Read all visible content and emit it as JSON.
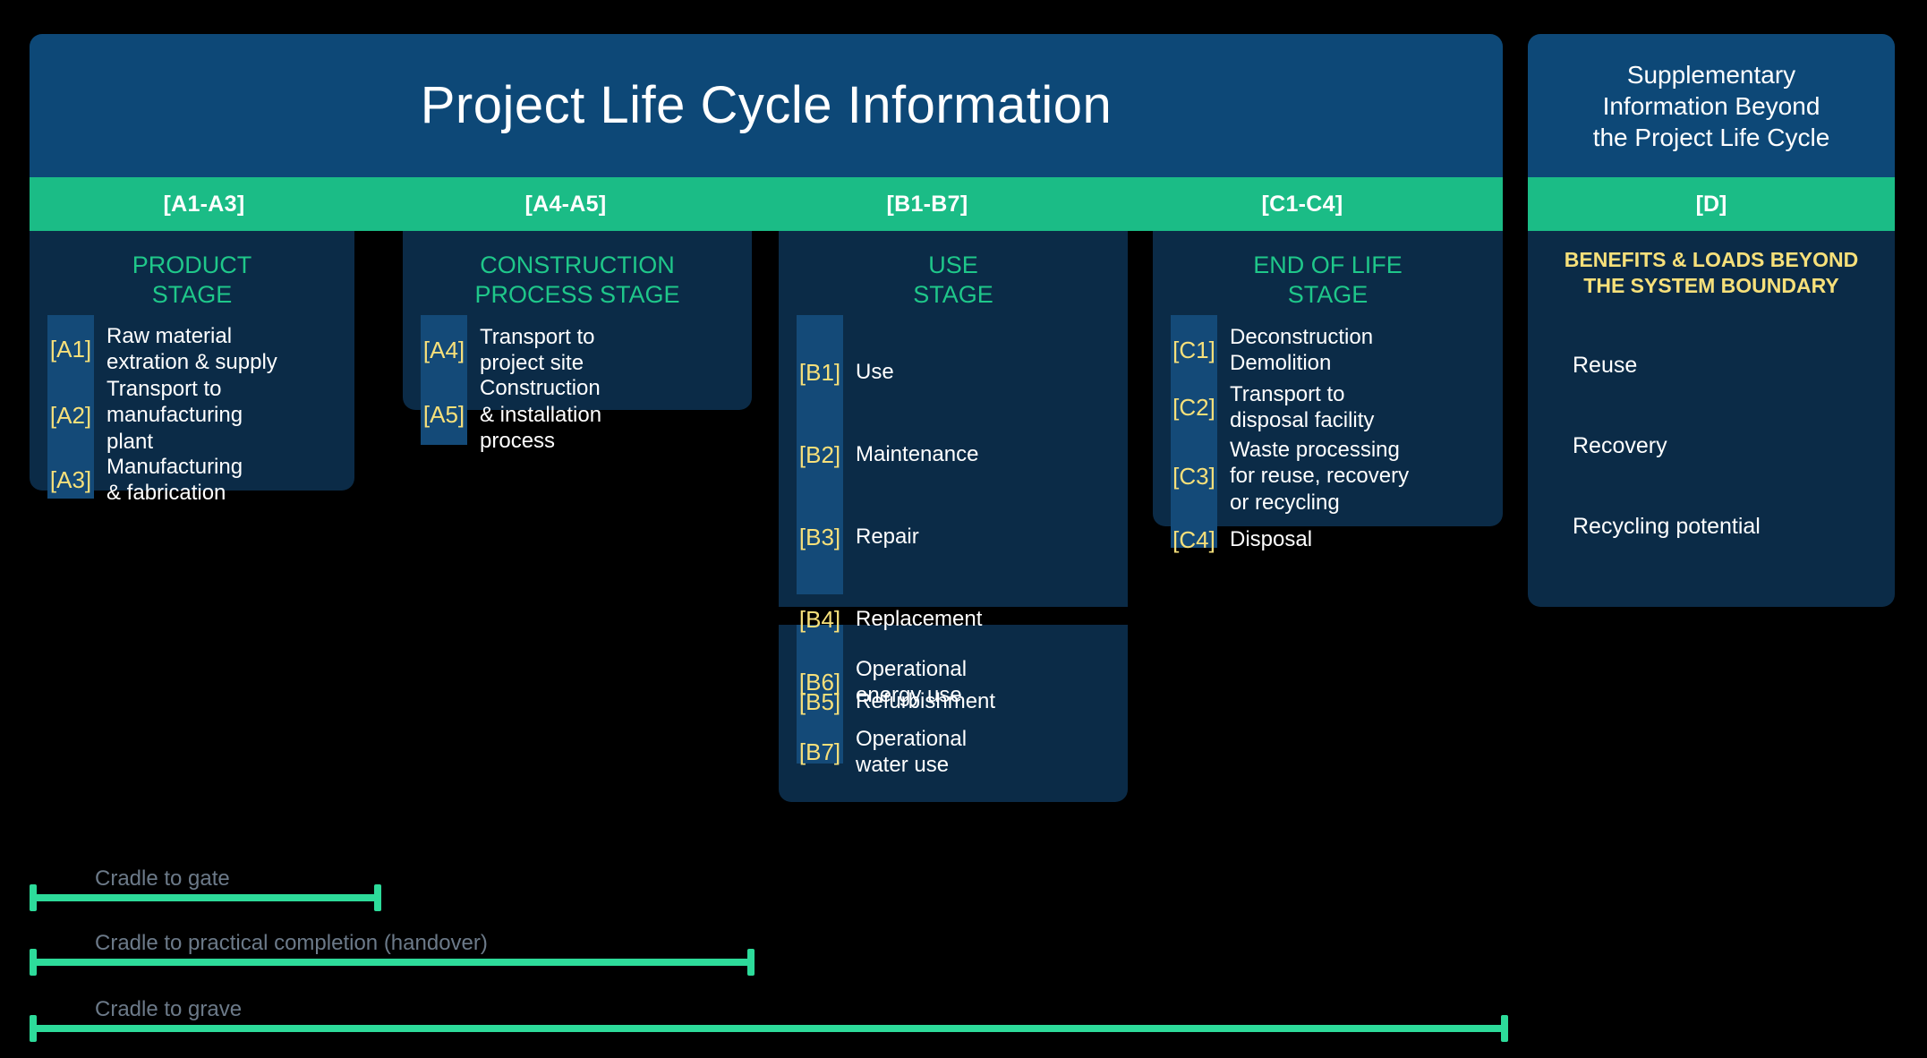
{
  "main": {
    "title": "Project Life Cycle Information",
    "code_bands": [
      "[A1-A3]",
      "[A4-A5]",
      "[B1-B7]",
      "[C1-C4]"
    ],
    "columns": [
      {
        "stage_title": "PRODUCT\nSTAGE",
        "items": [
          {
            "code": "[A1]",
            "label": "Raw material\nextration & supply"
          },
          {
            "code": "[A2]",
            "label": "Transport to\nmanufacturing\nplant"
          },
          {
            "code": "[A3]",
            "label": "Manufacturing\n& fabrication"
          }
        ]
      },
      {
        "stage_title": "CONSTRUCTION\nPROCESS STAGE",
        "items": [
          {
            "code": "[A4]",
            "label": "Transport to\nproject site"
          },
          {
            "code": "[A5]",
            "label": "Construction\n& installation\nprocess"
          }
        ]
      },
      {
        "stage_title": "USE\nSTAGE",
        "items": [
          {
            "code": "[B1]",
            "label": "Use"
          },
          {
            "code": "[B2]",
            "label": "Maintenance"
          },
          {
            "code": "[B3]",
            "label": "Repair"
          },
          {
            "code": "[B4]",
            "label": "Replacement"
          },
          {
            "code": "[B5]",
            "label": "Refurbishment"
          }
        ],
        "items_lower": [
          {
            "code": "[B6]",
            "label": "Operational\nenergy use"
          },
          {
            "code": "[B7]",
            "label": "Operational\nwater use"
          }
        ]
      },
      {
        "stage_title": "END OF LIFE\nSTAGE",
        "items": [
          {
            "code": "[C1]",
            "label": "Deconstruction\nDemolition"
          },
          {
            "code": "[C2]",
            "label": "Transport to\ndisposal facility"
          },
          {
            "code": "[C3]",
            "label": "Waste processing\nfor reuse, recovery\nor recycling"
          },
          {
            "code": "[C4]",
            "label": "Disposal"
          }
        ]
      }
    ]
  },
  "supplementary": {
    "title": "Supplementary\nInformation Beyond\nthe Project Life Cycle",
    "code_band": "[D]",
    "subtitle": "BENEFITS & LOADS BEYOND\nTHE SYSTEM BOUNDARY",
    "items": [
      "Reuse",
      "Recovery",
      "Recycling potential"
    ]
  },
  "brackets": [
    {
      "label": "Cradle to gate"
    },
    {
      "label": "Cradle to practical completion (handover)"
    },
    {
      "label": "Cradle to grave"
    }
  ],
  "colors": {
    "header_blue": "#0d4877",
    "panel_blue": "#0b2b47",
    "rail_blue": "#144a78",
    "band_green": "#1bbc86",
    "stage_green": "#1fc78a",
    "code_yellow": "#f7e07a",
    "bracket_green": "#2ddb9a",
    "bracket_label_gray": "#6c7a89",
    "background": "#000000"
  }
}
